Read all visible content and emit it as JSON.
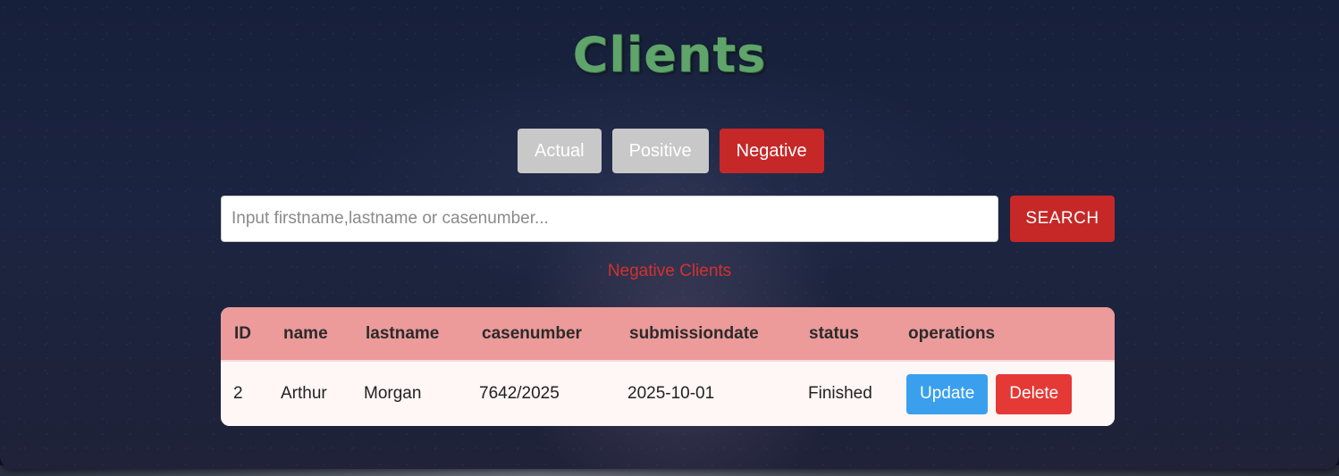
{
  "page": {
    "title": "Clients"
  },
  "filters": {
    "items": [
      {
        "label": "Actual",
        "active": false
      },
      {
        "label": "Positive",
        "active": false
      },
      {
        "label": "Negative",
        "active": true
      }
    ]
  },
  "search": {
    "placeholder": "Input firstname,lastname or casenumber...",
    "value": "",
    "button_label": "SEARCH"
  },
  "section_label": "Negative Clients",
  "table": {
    "columns": [
      "ID",
      "name",
      "lastname",
      "casenumber",
      "submissiondate",
      "status",
      "operations"
    ],
    "rows": [
      {
        "id": "2",
        "name": "Arthur",
        "lastname": "Morgan",
        "casenumber": "7642/2025",
        "submissiondate": "2025-10-01",
        "status": "Finished",
        "update_label": "Update",
        "delete_label": "Delete"
      }
    ]
  },
  "colors": {
    "title": "#5fa46a",
    "accent_red": "#c62828",
    "inactive_button": "#c8c8c8",
    "table_header": "#ec9a9a",
    "update_button": "#3aa0ee",
    "delete_button": "#e53935"
  }
}
